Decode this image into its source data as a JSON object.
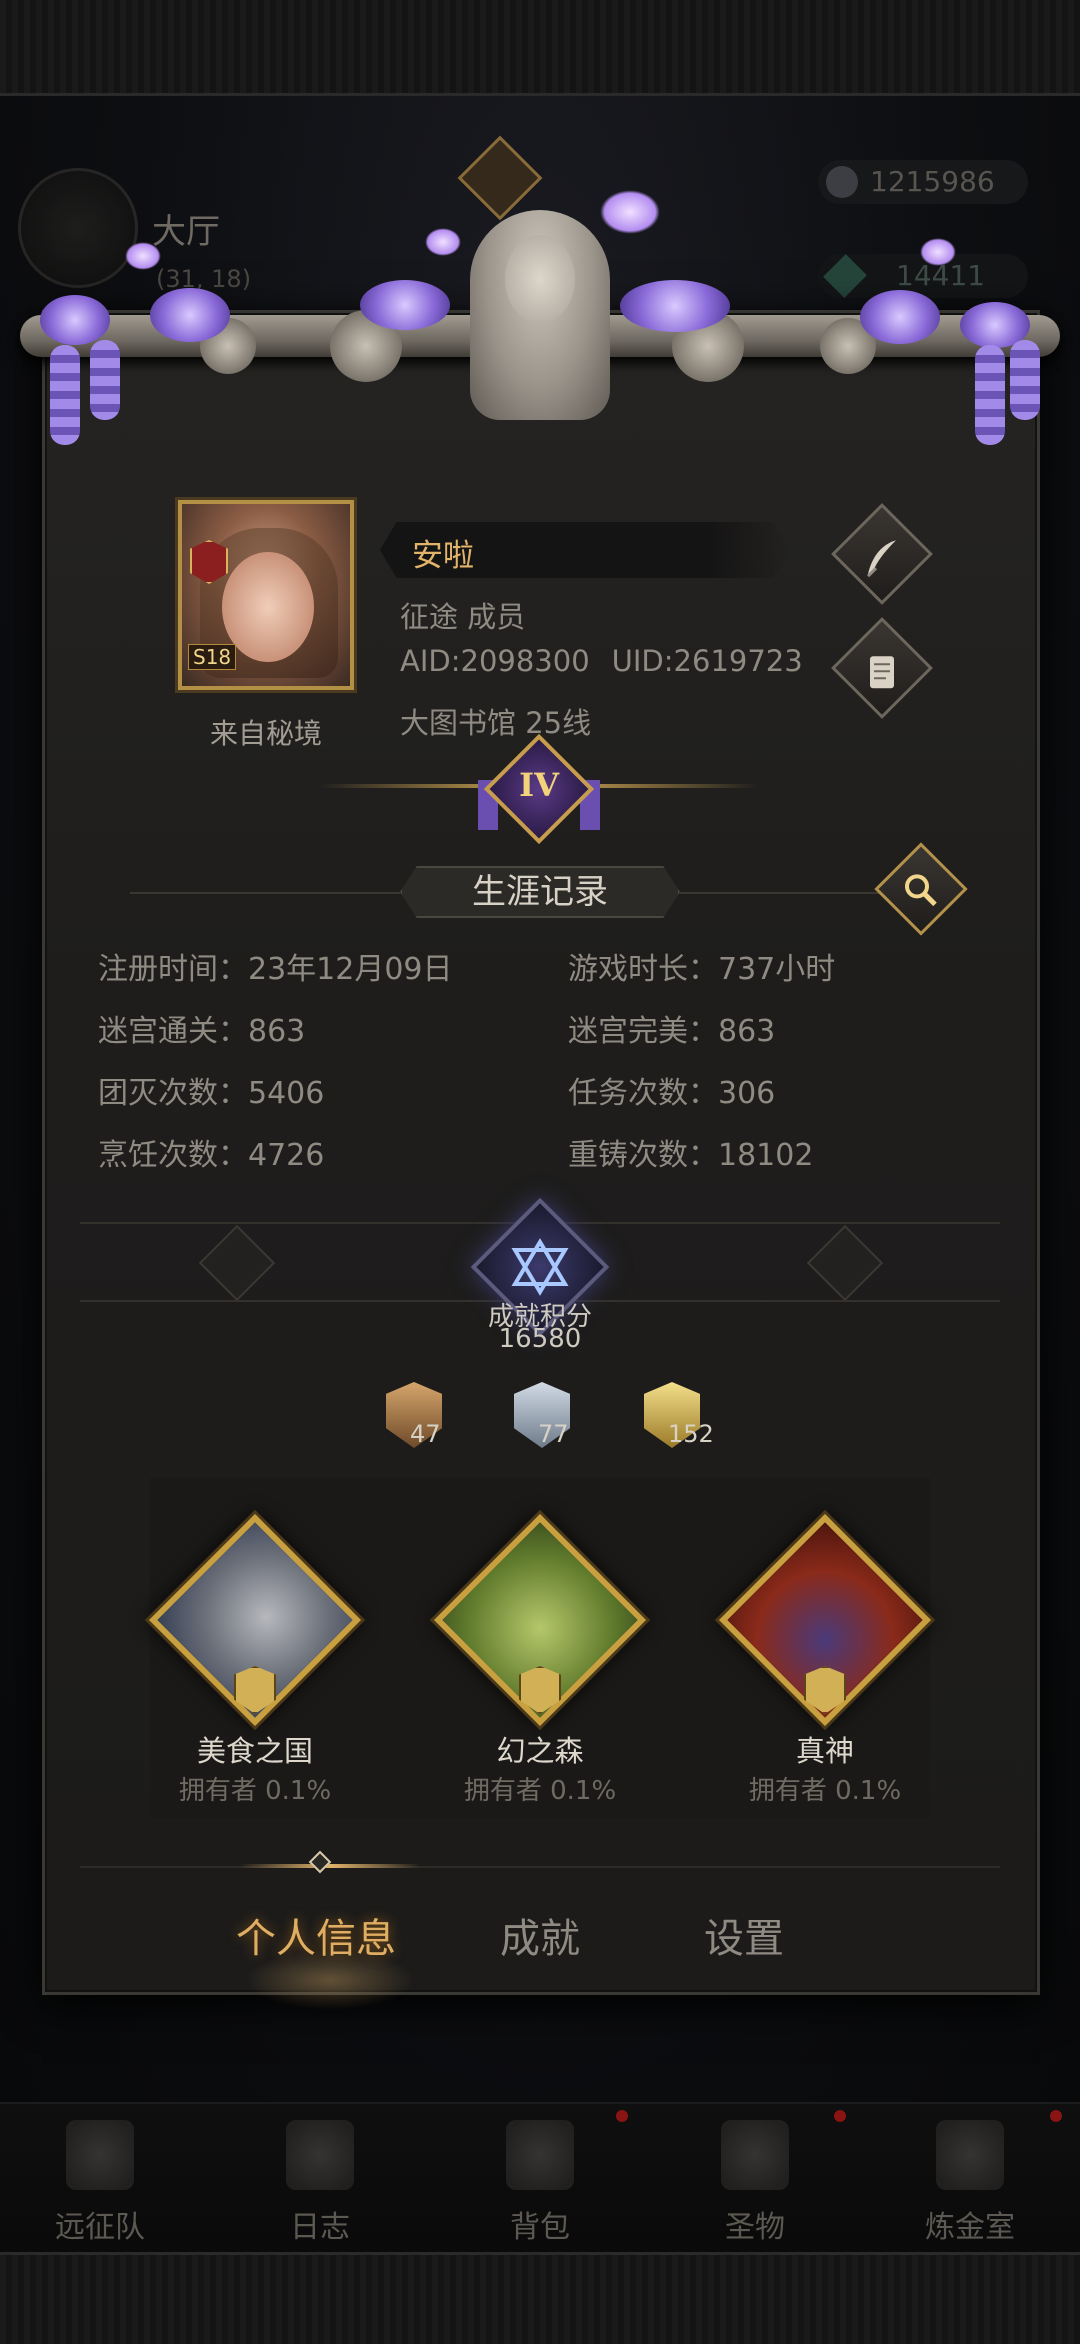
{
  "background": {
    "hall_title": "大厅",
    "hall_sub": "(31, 18)",
    "resource_1": "1215986",
    "resource_2": "14411"
  },
  "profile": {
    "player_name": "安啦",
    "guild": "征途 成员",
    "aid": "AID:2098300",
    "uid": "UID:2619723",
    "server": "大图书馆 25线",
    "from_label": "来自秘境",
    "avatar_level": "S18",
    "rank": "IV"
  },
  "career": {
    "title": "生涯记录",
    "stats": [
      {
        "label": "注册时间：",
        "value": "23年12月09日"
      },
      {
        "label": "游戏时长：",
        "value": "737小时"
      },
      {
        "label": "迷宫通关：",
        "value": "863"
      },
      {
        "label": "迷宫完美：",
        "value": "863"
      },
      {
        "label": "团灭次数：",
        "value": "5406"
      },
      {
        "label": "任务次数：",
        "value": "306"
      },
      {
        "label": "烹饪次数：",
        "value": "4726"
      },
      {
        "label": "重铸次数：",
        "value": "18102"
      }
    ]
  },
  "achievement": {
    "label": "成就积分",
    "score": "16580",
    "medals": [
      {
        "tier": "bronze",
        "count": "47"
      },
      {
        "tier": "silver",
        "count": "77"
      },
      {
        "tier": "gold",
        "count": "152"
      }
    ],
    "trophies": [
      {
        "name": "美食之国",
        "owner": "拥有者 0.1%"
      },
      {
        "name": "幻之森",
        "owner": "拥有者 0.1%"
      },
      {
        "name": "真神",
        "owner": "拥有者 0.1%"
      }
    ]
  },
  "tabs": [
    {
      "label": "个人信息",
      "active": true
    },
    {
      "label": "成就",
      "active": false
    },
    {
      "label": "设置",
      "active": false
    }
  ],
  "bottom_nav": [
    {
      "label": "远征队"
    },
    {
      "label": "日志"
    },
    {
      "label": "背包"
    },
    {
      "label": "圣物"
    },
    {
      "label": "炼金室"
    }
  ],
  "colors": {
    "accent_gold": "#e0ae62",
    "panel_bg": "#1e1d1c",
    "text_muted": "#8f8a82"
  }
}
